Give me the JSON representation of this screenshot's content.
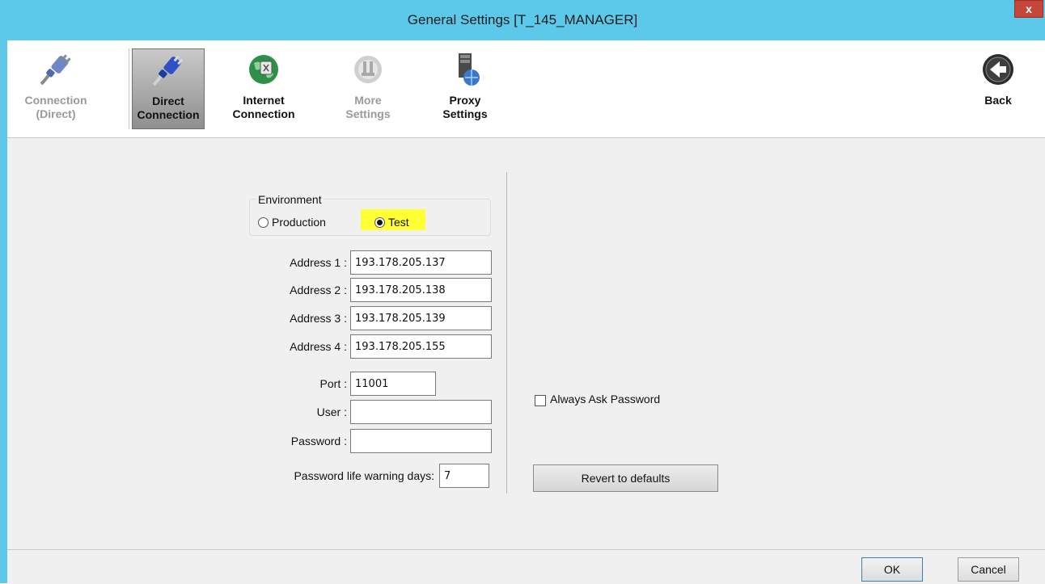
{
  "window": {
    "title": "General Settings [T_145_MANAGER]",
    "close_label": "x"
  },
  "toolbar": {
    "buttons": [
      {
        "label": "Connection\n(Direct)",
        "icon": "plug-icon",
        "state": "disabled"
      },
      {
        "label": "Direct\nConnection",
        "icon": "plug-icon",
        "state": "active"
      },
      {
        "label": "Internet\nConnection",
        "icon": "globe-icon",
        "state": "normal"
      },
      {
        "label": "More\nSettings",
        "icon": "settings-icon",
        "state": "disabled"
      },
      {
        "label": "Proxy\nSettings",
        "icon": "proxy-server-icon",
        "state": "normal"
      }
    ],
    "back_label": "Back"
  },
  "environment": {
    "group_label": "Environment",
    "options": [
      {
        "label": "Production",
        "selected": false
      },
      {
        "label": "Test",
        "selected": true
      }
    ]
  },
  "form": {
    "address1_label": "Address 1 :",
    "address1_value": "193.178.205.137",
    "address2_label": "Address 2 :",
    "address2_value": "193.178.205.138",
    "address3_label": "Address 3 :",
    "address3_value": "193.178.205.139",
    "address4_label": "Address 4 :",
    "address4_value": "193.178.205.155",
    "port_label": "Port :",
    "port_value": "11001",
    "user_label": "User :",
    "user_value": "",
    "password_label": "Password :",
    "password_value": "",
    "warning_days_label": "Password life warning days:",
    "warning_days_value": "7"
  },
  "options": {
    "always_ask_label": "Always Ask Password",
    "always_ask_checked": false,
    "revert_label": "Revert to defaults"
  },
  "footer": {
    "ok_label": "OK",
    "cancel_label": "Cancel"
  },
  "colors": {
    "titlebar": "#5cc9ea",
    "close": "#c7463c",
    "highlight": "#ffff33"
  }
}
